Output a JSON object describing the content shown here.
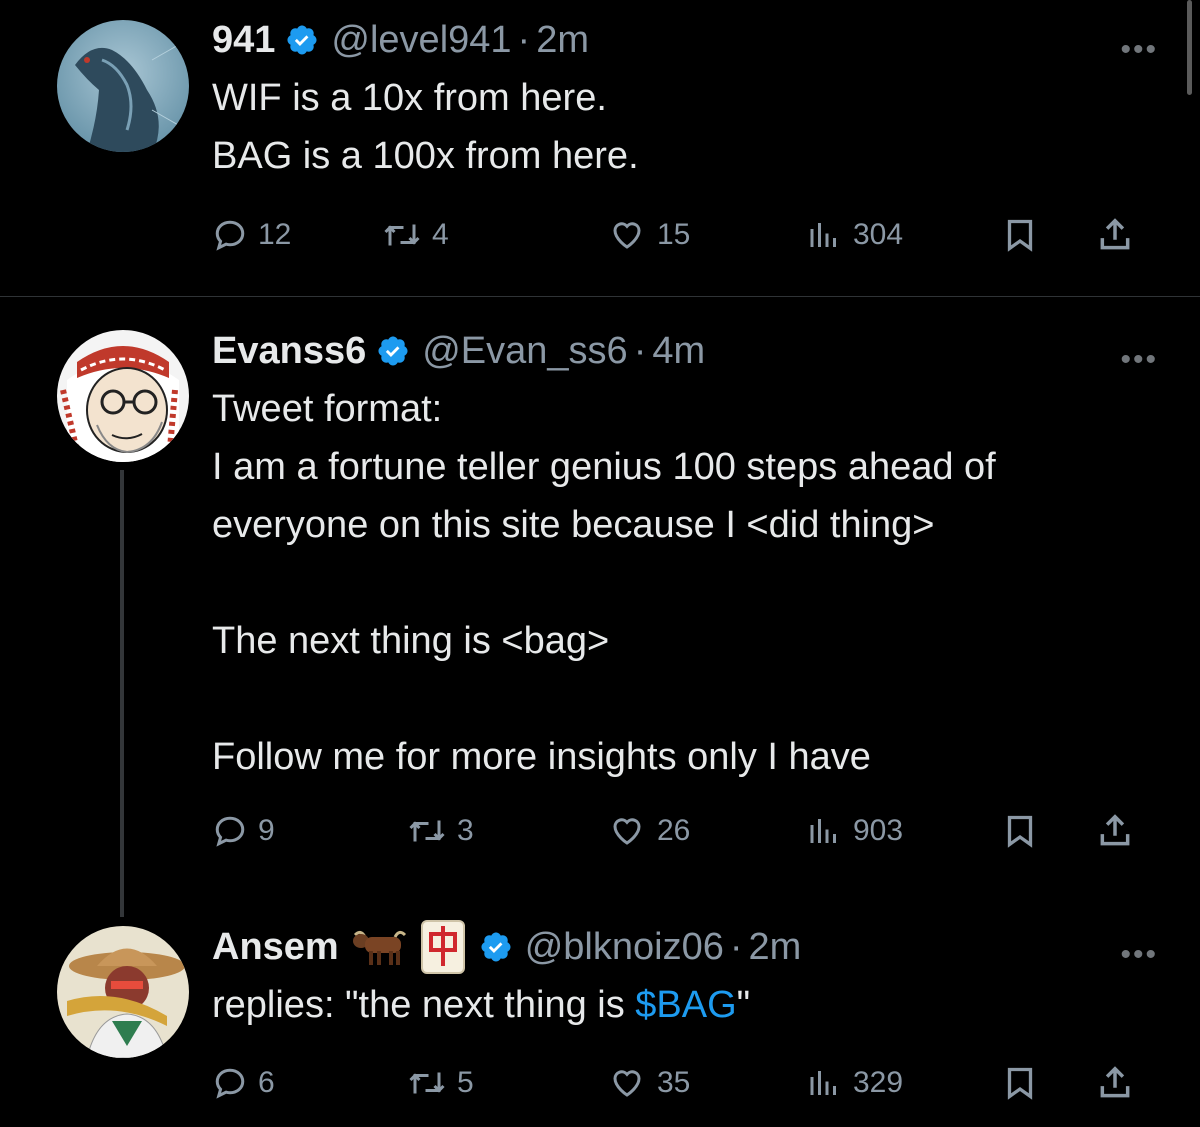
{
  "tweets": [
    {
      "name": "941",
      "handle": "@level941",
      "time": "2m",
      "text_lines": [
        "WIF is a 10x from here.",
        "BAG is a 100x from here."
      ],
      "replies": "12",
      "retweets": "4",
      "likes": "15",
      "views": "304"
    },
    {
      "name": "Evanss6",
      "handle": "@Evan_ss6",
      "time": "4m",
      "text": "Tweet format:\nI am a fortune teller genius 100 steps ahead of\neveryone on this site because I <did thing>\n\nThe next thing is <bag>\n\nFollow me for more insights only I have",
      "replies": "9",
      "retweets": "3",
      "likes": "26",
      "views": "903"
    },
    {
      "name": "Ansem",
      "handle": "@blknoiz06",
      "time": "2m",
      "text_prefix": "replies: \"the next thing is ",
      "text_link": "$BAG",
      "text_suffix": "\"",
      "replies": "6",
      "retweets": "5",
      "likes": "35",
      "views": "329"
    }
  ],
  "ui": {
    "separator": "·",
    "more": "•••"
  },
  "icons": {
    "verified": "verified-badge-icon",
    "reply": "reply-icon",
    "retweet": "retweet-icon",
    "like": "heart-icon",
    "views": "views-icon",
    "bookmark": "bookmark-icon",
    "share": "share-icon",
    "ox": "ox-emoji-icon",
    "mahjong": "mahjong-red-dragon-emoji-icon"
  },
  "colors": {
    "background": "#000000",
    "text": "#e7e9ea",
    "secondary": "#8b98a5",
    "accent": "#1d9bf0",
    "divider": "#2f3336"
  }
}
